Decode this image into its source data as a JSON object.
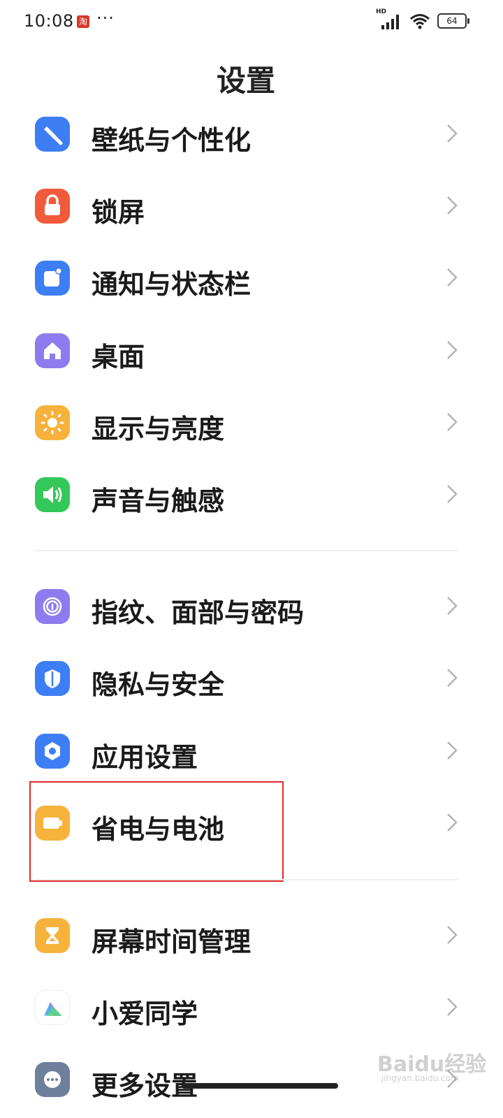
{
  "status_bar": {
    "time": "10:08",
    "app_badge": "淘",
    "more": "···",
    "network_badge": "HD",
    "battery": "64"
  },
  "header": {
    "title": "设置"
  },
  "items": [
    {
      "label": "壁纸与个性化",
      "icon": "palette-brush-icon",
      "color": "#3d7ef5"
    },
    {
      "label": "锁屏",
      "icon": "lock-icon",
      "color": "#f15a3b"
    },
    {
      "label": "通知与状态栏",
      "icon": "notification-icon",
      "color": "#3d7ef5"
    },
    {
      "label": "桌面",
      "icon": "home-icon",
      "color": "#8f7bf0"
    },
    {
      "label": "显示与亮度",
      "icon": "sun-icon",
      "color": "#f7b23b"
    },
    {
      "label": "声音与触感",
      "icon": "speaker-icon",
      "color": "#34c759"
    },
    {
      "label": "指纹、面部与密码",
      "icon": "fingerprint-icon",
      "color": "#8f7bf0"
    },
    {
      "label": "隐私与安全",
      "icon": "shield-icon",
      "color": "#3d7ef5"
    },
    {
      "label": "应用设置",
      "icon": "hexagon-settings-icon",
      "color": "#3d7ef5"
    },
    {
      "label": "省电与电池",
      "icon": "battery-icon",
      "color": "#f7b23b"
    },
    {
      "label": "屏幕时间管理",
      "icon": "hourglass-icon",
      "color": "#f7b23b"
    },
    {
      "label": "小爱同学",
      "icon": "xiaoai-assistant-icon",
      "color": "#ffffff"
    },
    {
      "label": "更多设置",
      "icon": "more-icon",
      "color": "#6e7f9c"
    }
  ],
  "watermark": {
    "text": "Baidu经验",
    "sub": "jingyan.baidu.com"
  }
}
